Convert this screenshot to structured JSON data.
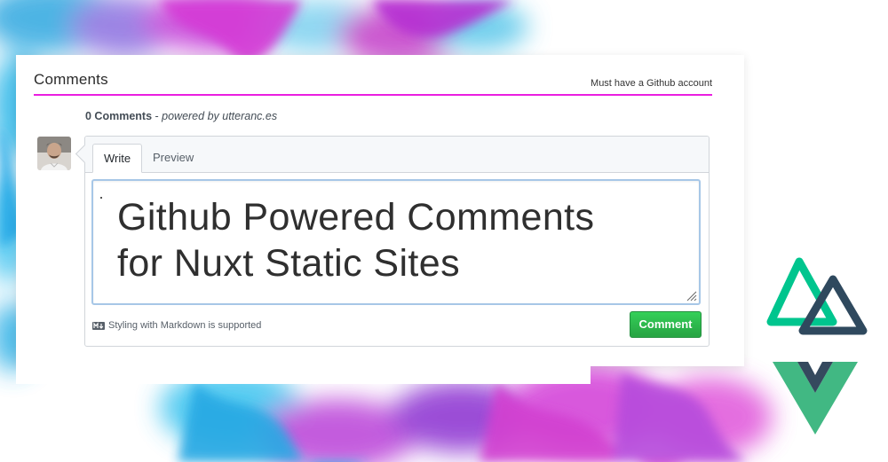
{
  "header": {
    "title": "Comments",
    "note": "Must have a Github account"
  },
  "thread": {
    "count_label": "0 Comments",
    "separator": " - ",
    "powered_label": "powered by utteranc.es"
  },
  "editor": {
    "tabs": [
      {
        "label": "Write",
        "active": true
      },
      {
        "label": "Preview",
        "active": false
      }
    ],
    "text_line1": "Github Powered Comments",
    "text_line2": "for Nuxt Static Sites",
    "markdown_note": "Styling with Markdown is supported",
    "submit_label": "Comment"
  },
  "icons": {
    "markdown": "markdown-icon",
    "resize": "resize-grip-icon",
    "nuxt": "nuxt-logo",
    "vue": "vue-logo"
  },
  "colors": {
    "accent_underline": "#ea1ee0",
    "button_green": "#28a745",
    "nuxt_green": "#00c58e",
    "nuxt_dark": "#2f495e",
    "vue_green": "#41b883",
    "vue_dark": "#35495e"
  }
}
